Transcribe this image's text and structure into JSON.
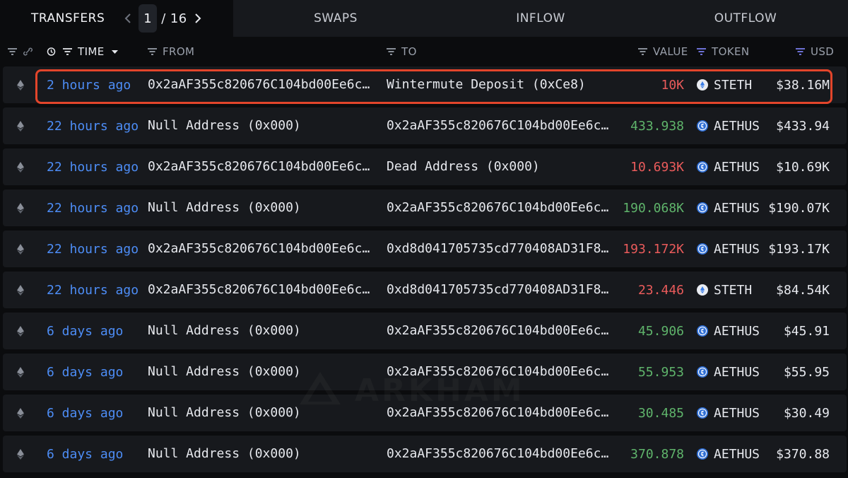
{
  "tabs": {
    "transfers": "TRANSFERS",
    "swaps": "SWAPS",
    "inflow": "INFLOW",
    "outflow": "OUTFLOW"
  },
  "pager": {
    "current": "1",
    "separator": "/",
    "total": "16"
  },
  "columns": {
    "time": "TIME",
    "from": "FROM",
    "to": "TO",
    "value": "VALUE",
    "token": "TOKEN",
    "usd": "USD"
  },
  "watermark": "ARKHAM",
  "colors": {
    "time_link": "#4d8df6",
    "negative": "#ea5b5b",
    "positive": "#5fb46b",
    "highlight": "#e3452b"
  },
  "rows": [
    {
      "time": "2 hours ago",
      "from": "0x2aAF355c820676C104bd00Ee6c5…",
      "to": "Wintermute Deposit (0xCe8)",
      "value": "10K",
      "sign": "neg",
      "token": "STETH",
      "token_icon": "steth-icon",
      "usd": "$38.16M"
    },
    {
      "time": "22 hours ago",
      "from": "Null Address (0x000)",
      "to": "0x2aAF355c820676C104bd00Ee6c5…",
      "value": "433.938",
      "sign": "pos",
      "token": "AETHUS",
      "token_icon": "aethus-icon",
      "usd": "$433.94"
    },
    {
      "time": "22 hours ago",
      "from": "0x2aAF355c820676C104bd00Ee6c5…",
      "to": "Dead Address (0x000)",
      "value": "10.693K",
      "sign": "neg",
      "token": "AETHUS",
      "token_icon": "aethus-icon",
      "usd": "$10.69K"
    },
    {
      "time": "22 hours ago",
      "from": "Null Address (0x000)",
      "to": "0x2aAF355c820676C104bd00Ee6c5…",
      "value": "190.068K",
      "sign": "pos",
      "token": "AETHUS",
      "token_icon": "aethus-icon",
      "usd": "$190.07K"
    },
    {
      "time": "22 hours ago",
      "from": "0x2aAF355c820676C104bd00Ee6c5…",
      "to": "0xd8d041705735cd770408AD31F88…",
      "value": "193.172K",
      "sign": "neg",
      "token": "AETHUS",
      "token_icon": "aethus-icon",
      "usd": "$193.17K"
    },
    {
      "time": "22 hours ago",
      "from": "0x2aAF355c820676C104bd00Ee6c5…",
      "to": "0xd8d041705735cd770408AD31F88…",
      "value": "23.446",
      "sign": "neg",
      "token": "STETH",
      "token_icon": "steth-icon",
      "usd": "$84.54K"
    },
    {
      "time": "6 days ago",
      "from": "Null Address (0x000)",
      "to": "0x2aAF355c820676C104bd00Ee6c5…",
      "value": "45.906",
      "sign": "pos",
      "token": "AETHUS",
      "token_icon": "aethus-icon",
      "usd": "$45.91"
    },
    {
      "time": "6 days ago",
      "from": "Null Address (0x000)",
      "to": "0x2aAF355c820676C104bd00Ee6c5…",
      "value": "55.953",
      "sign": "pos",
      "token": "AETHUS",
      "token_icon": "aethus-icon",
      "usd": "$55.95"
    },
    {
      "time": "6 days ago",
      "from": "Null Address (0x000)",
      "to": "0x2aAF355c820676C104bd00Ee6c5…",
      "value": "30.485",
      "sign": "pos",
      "token": "AETHUS",
      "token_icon": "aethus-icon",
      "usd": "$30.49"
    },
    {
      "time": "6 days ago",
      "from": "Null Address (0x000)",
      "to": "0x2aAF355c820676C104bd00Ee6c5…",
      "value": "370.878",
      "sign": "pos",
      "token": "AETHUS",
      "token_icon": "aethus-icon",
      "usd": "$370.88"
    }
  ]
}
